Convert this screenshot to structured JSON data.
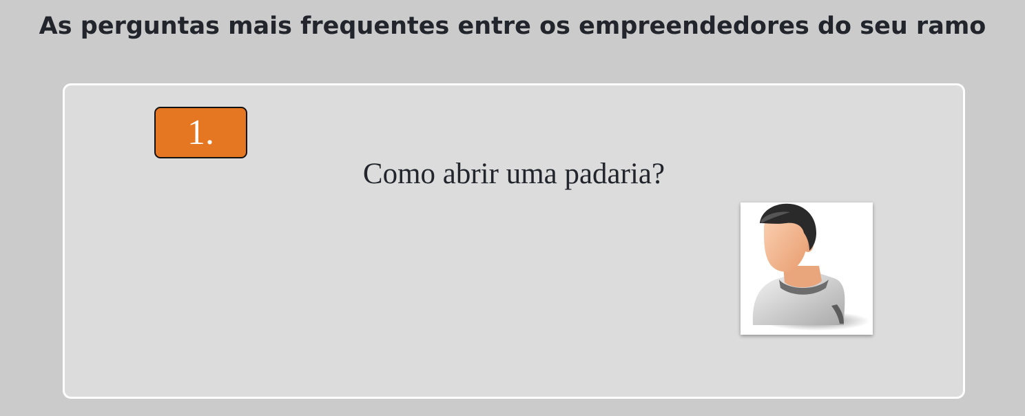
{
  "header": {
    "title": "As perguntas mais frequentes entre os empreendedores do seu ramo"
  },
  "faq": {
    "items": [
      {
        "number": "1.",
        "question": "Como abrir uma padaria?",
        "avatar_icon": "user-avatar-icon"
      }
    ]
  },
  "colors": {
    "page_background": "#cbcbcb",
    "card_background": "#dcdcdc",
    "badge": "#e67722",
    "text": "#22252c"
  }
}
